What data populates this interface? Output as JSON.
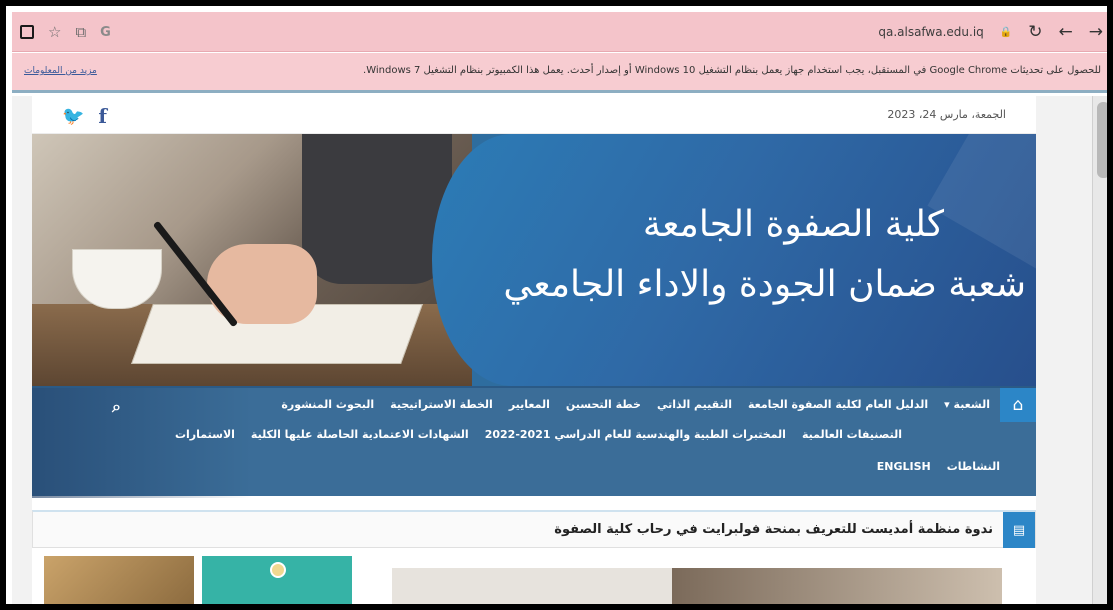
{
  "browser": {
    "url": "qa.alsafwa.edu.iq",
    "icons": [
      "window-icon",
      "star-icon",
      "tabs-icon",
      "google-icon",
      "lock-icon",
      "reload-icon",
      "back-icon",
      "forward-icon"
    ]
  },
  "notice": {
    "text": "للحصول على تحديثات Google Chrome في المستقبل، يجب استخدام جهاز يعمل بنظام التشغيل Windows 10 أو إصدار أحدث. يعمل هذا الكمبيوتر بنظام التشغيل Windows 7.",
    "link": "مزيد من المعلومات"
  },
  "site": {
    "date": "الجمعة، مارس 24، 2023",
    "social": [
      "twitter-icon",
      "facebook-icon"
    ],
    "banner": {
      "title": "كلية الصفوة الجامعة",
      "subtitle": "شعبة ضمان الجودة والاداء الجامعي"
    },
    "nav": {
      "row1": [
        "الشعبة ▾",
        "الدليل العام لكلية الصفوة الجامعة",
        "التقييم الذاتي",
        "خطة التحسين",
        "المعايير",
        "الخطة الاستراتيجية",
        "البحوث المنشورة"
      ],
      "row2": [
        "التصنيفات العالمية",
        "المختبرات الطبية والهندسية للعام الدراسي 2021-2022",
        "الشهادات الاعتمادية الحاصلة عليها الكلية",
        "الاستمارات"
      ],
      "row3": [
        "النشاطات",
        "ENGLISH"
      ]
    },
    "ticker": "ندوة منظمة أمديست للتعريف بمنحة فولبرايت في رحاب كلية الصفوة"
  },
  "colors": {
    "toolbar": "#f4c4ca",
    "banner_blue": "#2f69a6",
    "nav_blue": "#3b6d98",
    "accent": "#2c86c7"
  }
}
